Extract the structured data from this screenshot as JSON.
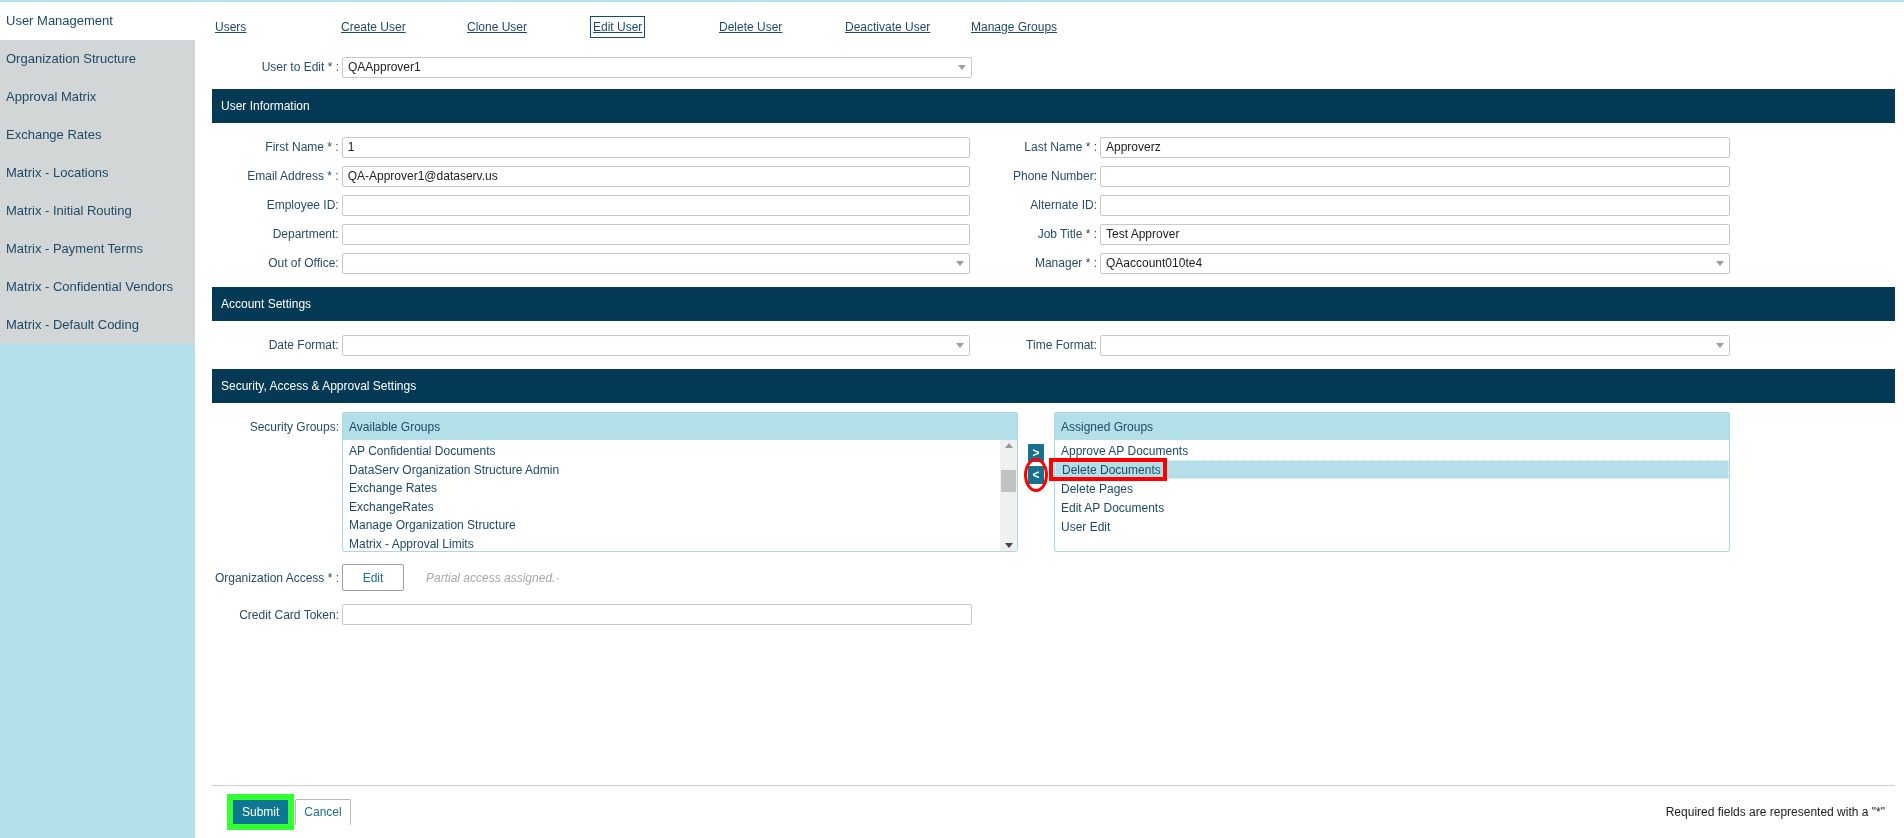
{
  "sidebar": {
    "items": [
      {
        "label": "User Management",
        "selected": true
      },
      {
        "label": "Organization Structure",
        "selected": false
      },
      {
        "label": "Approval Matrix",
        "selected": false
      },
      {
        "label": "Exchange Rates",
        "selected": false
      },
      {
        "label": "Matrix - Locations",
        "selected": false
      },
      {
        "label": "Matrix - Initial Routing",
        "selected": false
      },
      {
        "label": "Matrix - Payment Terms",
        "selected": false
      },
      {
        "label": "Matrix - Confidential Vendors",
        "selected": false
      },
      {
        "label": "Matrix - Default Coding",
        "selected": false
      }
    ]
  },
  "nav": {
    "links": [
      {
        "label": "Users",
        "selected": false
      },
      {
        "label": "Create User",
        "selected": false
      },
      {
        "label": "Clone User",
        "selected": false
      },
      {
        "label": "Edit User",
        "selected": true
      },
      {
        "label": "Delete User",
        "selected": false
      },
      {
        "label": "Deactivate User",
        "selected": false
      },
      {
        "label": "Manage Groups",
        "selected": false
      }
    ]
  },
  "user_to_edit": {
    "label": "User to Edit * :",
    "value": "QAApprover1",
    "kind": "select"
  },
  "user_information": {
    "title": "User Information",
    "rows": [
      [
        {
          "label": "First Name * :",
          "value": "1",
          "kind": "text"
        },
        {
          "label": "Last Name * :",
          "value": "Approverz",
          "kind": "text"
        }
      ],
      [
        {
          "label": "Email Address * :",
          "value": "QA-Approver1@dataserv.us",
          "kind": "text"
        },
        {
          "label": "Phone Number:",
          "kind": "text"
        }
      ],
      [
        {
          "label": "Employee ID:",
          "kind": "text"
        },
        {
          "label": "Alternate ID:",
          "kind": "text"
        }
      ],
      [
        {
          "label": "Department:",
          "kind": "text"
        },
        {
          "label": "Job Title * :",
          "value": "Test Approver",
          "kind": "text"
        }
      ],
      [
        {
          "label": "Out of Office:",
          "kind": "select"
        },
        {
          "label": "Manager * :",
          "value": "QAaccount010te4",
          "kind": "select"
        }
      ]
    ]
  },
  "account_settings": {
    "title": "Account Settings",
    "rows": [
      [
        {
          "label": "Date Format:",
          "kind": "select"
        },
        {
          "label": "Time Format:",
          "kind": "select"
        }
      ]
    ]
  },
  "security": {
    "title": "Security, Access & Approval Settings",
    "groups_label": "Security Groups:",
    "available": {
      "title": "Available Groups",
      "items": [
        {
          "label": "AP Confidential Documents",
          "selected": false
        },
        {
          "label": "DataServ Organization Structure Admin",
          "selected": false
        },
        {
          "label": "Exchange Rates",
          "selected": false
        },
        {
          "label": "ExchangeRates",
          "selected": false
        },
        {
          "label": "Manage Organization Structure",
          "selected": false
        },
        {
          "label": "Matrix - Approval Limits",
          "selected": false
        }
      ]
    },
    "add_button": {
      "label": ">"
    },
    "remove_button": {
      "label": "<",
      "color": "#ff0000"
    },
    "assigned": {
      "title": "Assigned Groups",
      "items": [
        {
          "label": "Approve AP Documents",
          "selected": false
        },
        {
          "label": "Delete Documents",
          "selected": true,
          "color": "#ff0000"
        },
        {
          "label": "Delete Pages",
          "selected": false
        },
        {
          "label": "Edit AP Documents",
          "selected": false
        },
        {
          "label": "User Edit",
          "selected": false
        }
      ]
    },
    "organization_access": {
      "label": "Organization Access * :",
      "button": "Edit",
      "note": "Partial access assigned.·"
    },
    "credit_card": {
      "label": "Credit Card Token:",
      "kind": "text"
    }
  },
  "footer": {
    "submit": {
      "label": "Submit",
      "color": "#33ff33"
    },
    "cancel": "Cancel",
    "note": "Required fields are represented with a \"*\""
  }
}
